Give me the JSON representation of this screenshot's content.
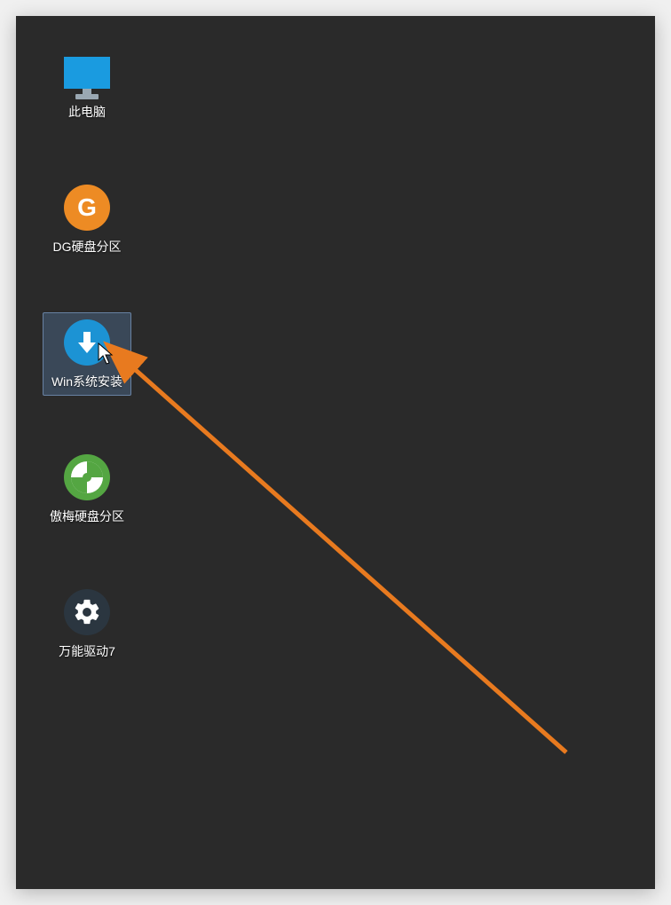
{
  "desktop": {
    "icons": [
      {
        "id": "this-pc",
        "label": "此电脑",
        "icon_name": "monitor-icon"
      },
      {
        "id": "dg-partition",
        "label": "DG硬盘分区",
        "icon_name": "g-letter-icon"
      },
      {
        "id": "win-installer",
        "label": "Win系统安装",
        "icon_name": "download-arrow-icon",
        "selected": true
      },
      {
        "id": "aomei-partition",
        "label": "傲梅硬盘分区",
        "icon_name": "pie-chart-icon"
      },
      {
        "id": "universal-driver",
        "label": "万能驱动7",
        "icon_name": "gear-icon"
      }
    ]
  },
  "annotation": {
    "arrow_color": "#e87a1f",
    "points_to": "win-installer"
  }
}
